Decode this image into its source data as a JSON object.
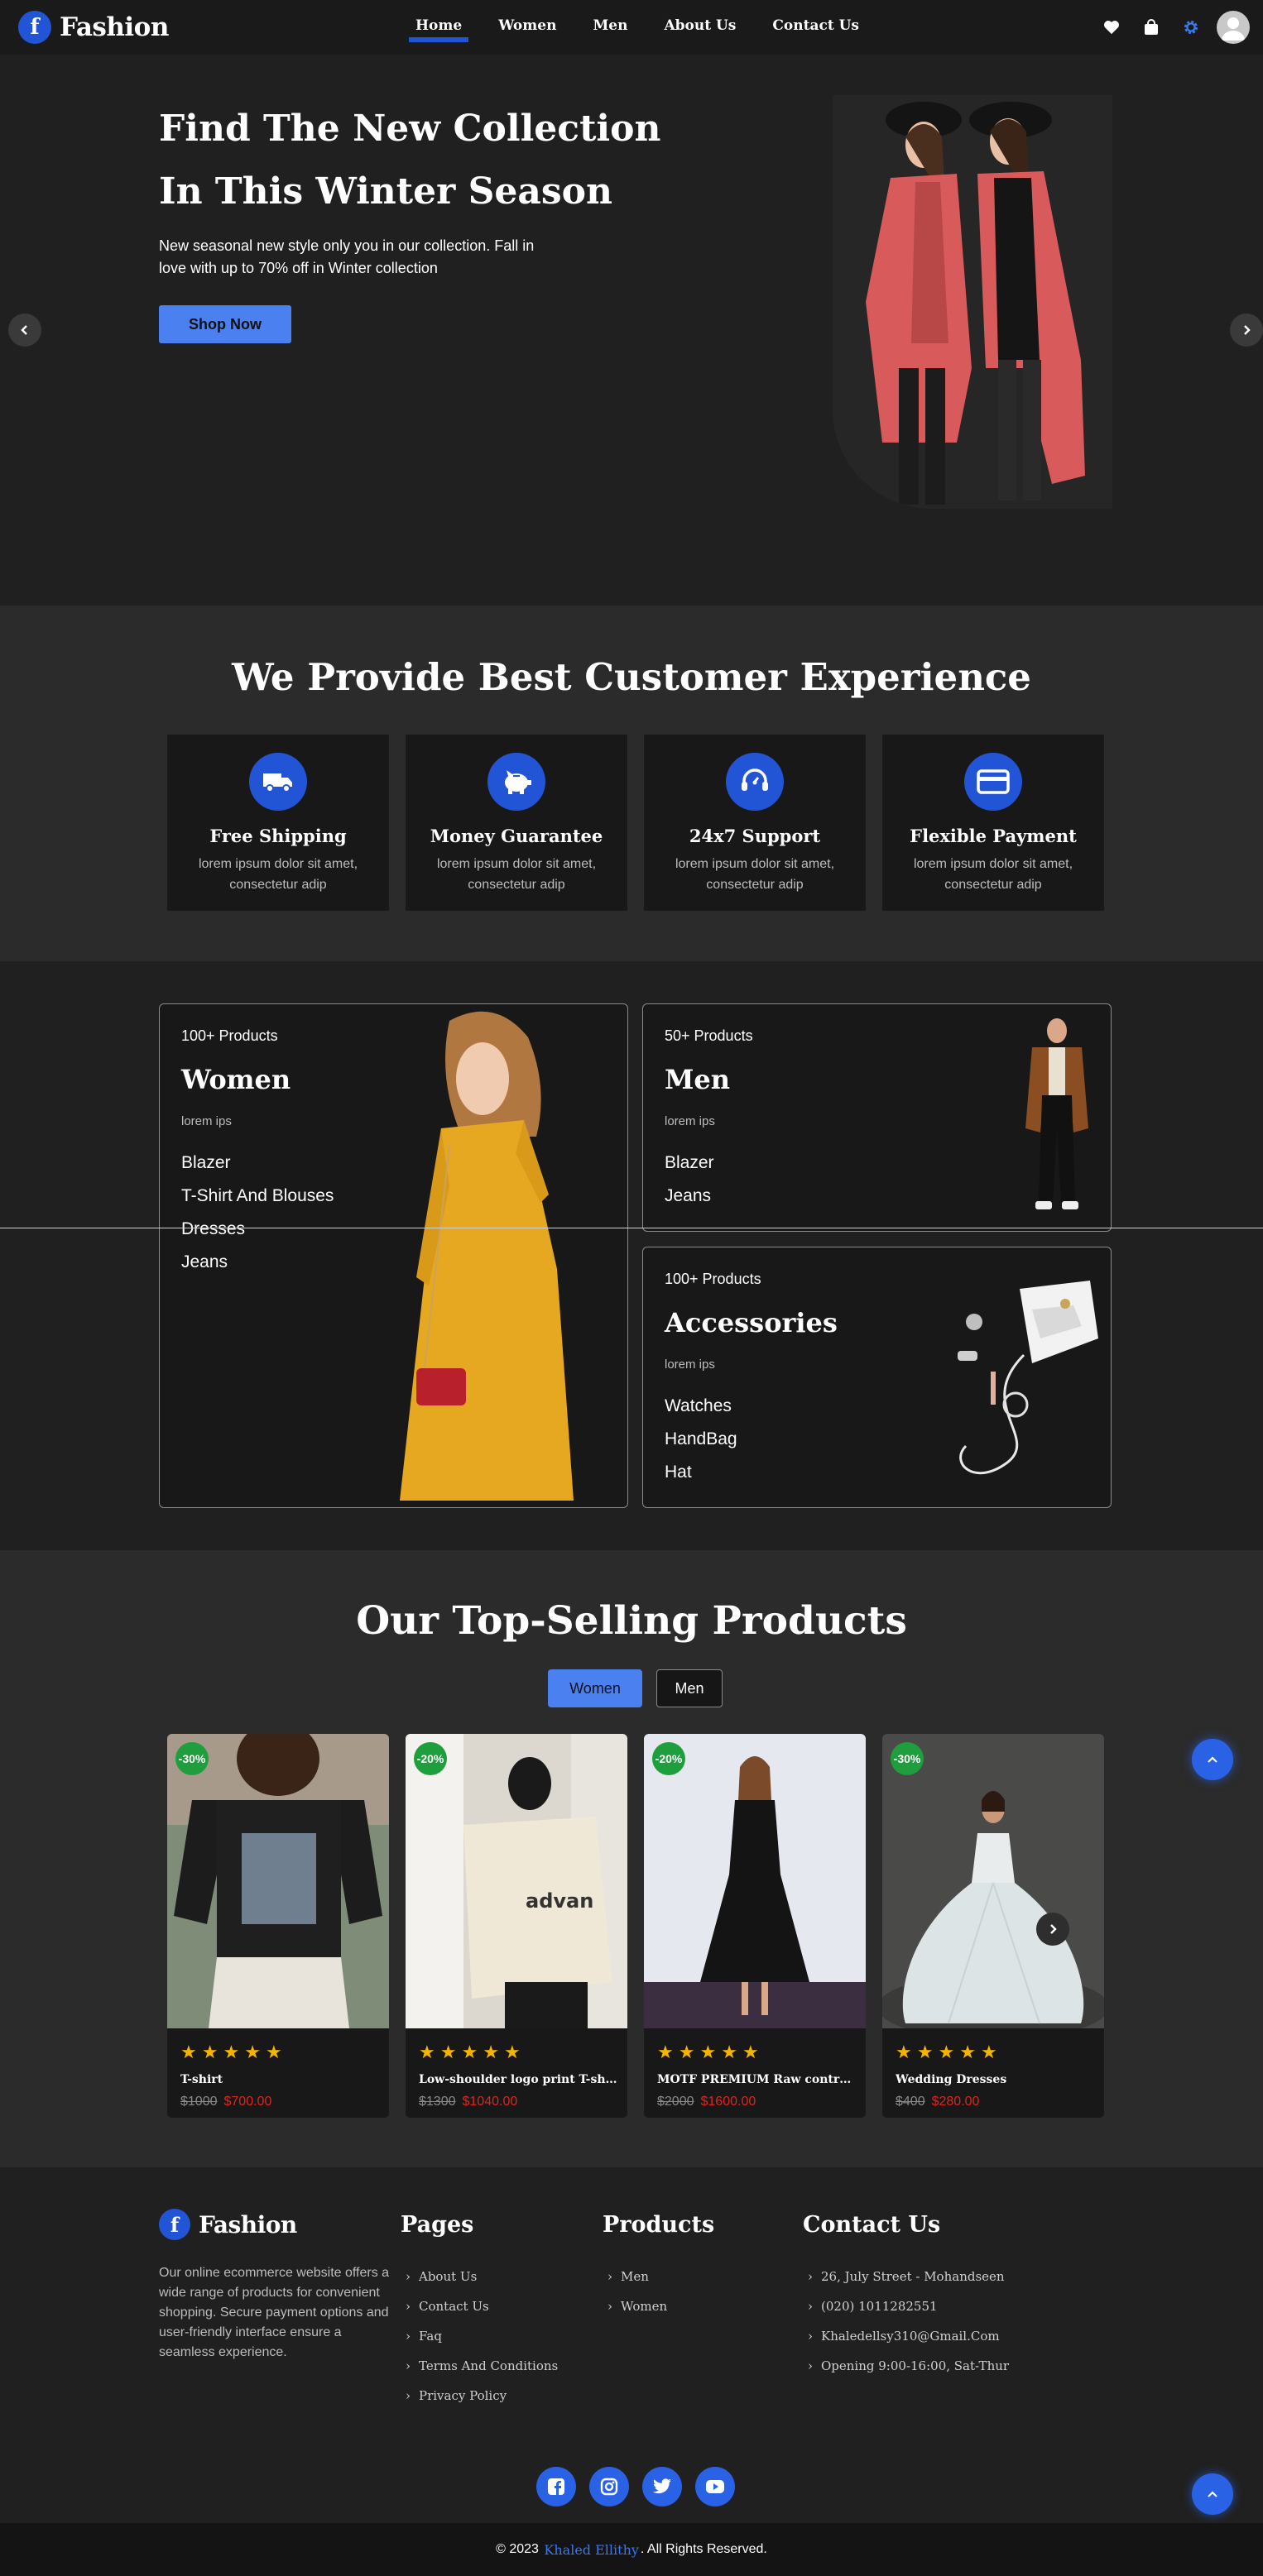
{
  "nav": {
    "logo_letter": "f",
    "brand": "Fashion",
    "menu": [
      {
        "label": "Home",
        "active": true
      },
      {
        "label": "Women",
        "active": false
      },
      {
        "label": "Men",
        "active": false
      },
      {
        "label": "About Us",
        "active": false
      },
      {
        "label": "Contact Us",
        "active": false
      }
    ],
    "icons": [
      "heart-icon",
      "shopping-bag-icon",
      "settings-gear-icon",
      "user-avatar-icon"
    ]
  },
  "hero": {
    "title_line1": "Find The New Collection",
    "title_line2": "In This Winter Season",
    "subtitle": "New seasonal new style only you in our collection. Fall in love with up to 70% off in Winter collection",
    "button": "Shop Now"
  },
  "experience": {
    "title": "We Provide Best Customer Experience",
    "cards": [
      {
        "icon": "truck-icon",
        "title": "Free Shipping",
        "desc": "lorem ipsum dolor sit amet, consectetur adip"
      },
      {
        "icon": "piggy-bank-icon",
        "title": "Money Guarantee",
        "desc": "lorem ipsum dolor sit amet, consectetur adip"
      },
      {
        "icon": "headset-icon",
        "title": "24x7 Support",
        "desc": "lorem ipsum dolor sit amet, consectetur adip"
      },
      {
        "icon": "credit-card-icon",
        "title": "Flexible Payment",
        "desc": "lorem ipsum dolor sit amet, consectetur adip"
      }
    ]
  },
  "categories": {
    "women": {
      "count": "100+ Products",
      "name": "Women",
      "lorem": "lorem ips",
      "links": [
        "Blazer",
        "T-Shirt And Blouses",
        "Dresses",
        "Jeans"
      ]
    },
    "men": {
      "count": "50+ Products",
      "name": "Men",
      "lorem": "lorem ips",
      "links": [
        "Blazer",
        "Jeans"
      ]
    },
    "accessories": {
      "count": "100+ Products",
      "name": "Accessories",
      "lorem": "lorem ips",
      "links": [
        "Watches",
        "HandBag",
        "Hat"
      ]
    }
  },
  "products": {
    "title": "Our Top-Selling Products",
    "tabs": [
      {
        "label": "Women",
        "active": true
      },
      {
        "label": "Men",
        "active": false
      }
    ],
    "items": [
      {
        "badge": "-30%",
        "name": "T-shirt",
        "old_price": "$1000",
        "new_price": "$700.00",
        "rating": 5
      },
      {
        "badge": "-20%",
        "name": "Low-shoulder logo print T-shirt",
        "old_price": "$1300",
        "new_price": "$1040.00",
        "rating": 5
      },
      {
        "badge": "-20%",
        "name": "MOTF PREMIUM Raw contrast ..",
        "old_price": "$2000",
        "new_price": "$1600.00",
        "rating": 5
      },
      {
        "badge": "-30%",
        "name": "Wedding Dresses",
        "old_price": "$400",
        "new_price": "$280.00",
        "rating": 5
      }
    ]
  },
  "footer": {
    "brand": "Fashion",
    "logo_letter": "f",
    "about": "Our online ecommerce website offers a wide range of products for convenient shopping. Secure payment options and user-friendly interface ensure a seamless experience.",
    "pages_title": "Pages",
    "pages": [
      "About Us",
      "Contact Us",
      "Faq",
      "Terms And Conditions",
      "Privacy Policy"
    ],
    "products_title": "Products",
    "products": [
      "Men",
      "Women"
    ],
    "contact_title": "Contact Us",
    "contact": [
      "26, July Street - Mohandseen",
      "(020) 1011282551",
      "Khaledellsy310@Gmail.Com",
      "Opening 9:00-16:00, Sat-Thur"
    ],
    "socials": [
      "facebook-icon",
      "instagram-icon",
      "twitter-icon",
      "youtube-icon"
    ],
    "copyright_prefix": "© 2023",
    "copyright_name": "Khaled Ellithy",
    "copyright_suffix": ". All Rights Reserved."
  },
  "colors": {
    "accent": "#2255d6",
    "button": "#4a80f0",
    "discount_badge": "#1e9e3d",
    "sale_price": "#e0241b",
    "star": "#f5b400"
  }
}
